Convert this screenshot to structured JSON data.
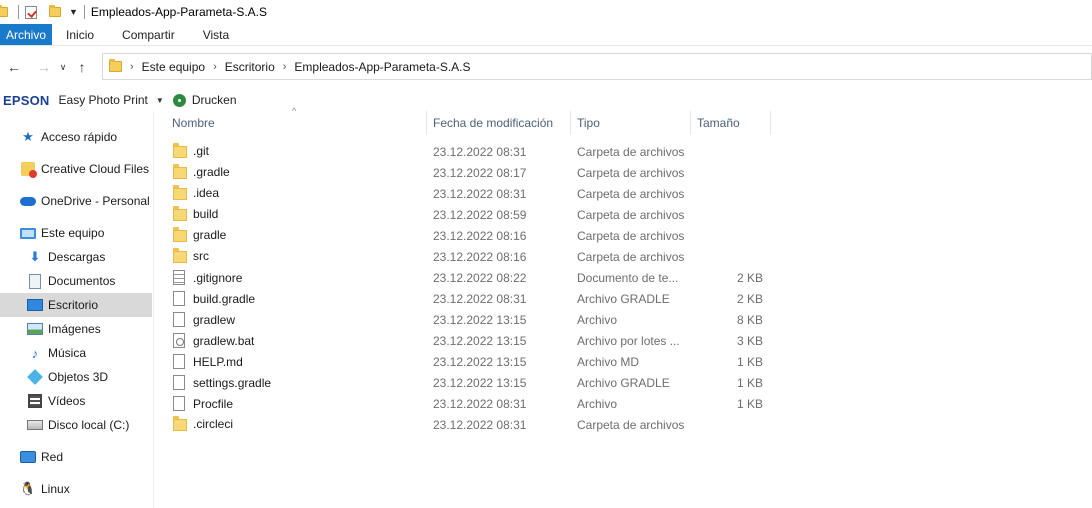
{
  "window": {
    "title": "Empleados-App-Parameta-S.A.S"
  },
  "ribbon": {
    "tabs": [
      {
        "label": "Archivo",
        "active": true
      },
      {
        "label": "Inicio",
        "active": false
      },
      {
        "label": "Compartir",
        "active": false
      },
      {
        "label": "Vista",
        "active": false
      }
    ]
  },
  "address": {
    "crumbs": [
      "Este equipo",
      "Escritorio",
      "Empleados-App-Parameta-S.A.S"
    ]
  },
  "epson_toolbar": {
    "logo": "EPSON",
    "app_label": "Easy Photo Print",
    "print_label": "Drucken"
  },
  "navpane": {
    "items": [
      {
        "label": "Acceso rápido",
        "icon": "star-icon",
        "level": 1
      },
      {
        "label": "Creative Cloud Files",
        "icon": "creative-cloud-icon",
        "level": 1
      },
      {
        "label": "OneDrive - Personal",
        "icon": "onedrive-cloud-icon",
        "level": 1
      },
      {
        "label": "Este equipo",
        "icon": "computer-icon",
        "level": 1
      },
      {
        "label": "Descargas",
        "icon": "download-icon",
        "level": 2
      },
      {
        "label": "Documentos",
        "icon": "document-icon",
        "level": 2
      },
      {
        "label": "Escritorio",
        "icon": "desktop-icon",
        "level": 2,
        "selected": true
      },
      {
        "label": "Imágenes",
        "icon": "pictures-icon",
        "level": 2
      },
      {
        "label": "Música",
        "icon": "music-icon",
        "level": 2
      },
      {
        "label": "Objetos 3D",
        "icon": "3d-objects-icon",
        "level": 2
      },
      {
        "label": "Vídeos",
        "icon": "video-icon",
        "level": 2
      },
      {
        "label": "Disco local (C:)",
        "icon": "disk-icon",
        "level": 2
      },
      {
        "label": "Red",
        "icon": "network-icon",
        "level": 1
      },
      {
        "label": "Linux",
        "icon": "linux-penguin-icon",
        "level": 1
      }
    ]
  },
  "columns": {
    "name": "Nombre",
    "date": "Fecha de modificación",
    "type": "Tipo",
    "size": "Tamaño"
  },
  "files": [
    {
      "name": ".git",
      "date": "23.12.2022 08:31",
      "type": "Carpeta de archivos",
      "size": "",
      "icon": "folder"
    },
    {
      "name": ".gradle",
      "date": "23.12.2022 08:17",
      "type": "Carpeta de archivos",
      "size": "",
      "icon": "folder"
    },
    {
      "name": ".idea",
      "date": "23.12.2022 08:31",
      "type": "Carpeta de archivos",
      "size": "",
      "icon": "folder"
    },
    {
      "name": "build",
      "date": "23.12.2022 08:59",
      "type": "Carpeta de archivos",
      "size": "",
      "icon": "folder"
    },
    {
      "name": "gradle",
      "date": "23.12.2022 08:16",
      "type": "Carpeta de archivos",
      "size": "",
      "icon": "folder"
    },
    {
      "name": "src",
      "date": "23.12.2022 08:16",
      "type": "Carpeta de archivos",
      "size": "",
      "icon": "folder"
    },
    {
      "name": ".gitignore",
      "date": "23.12.2022 08:22",
      "type": "Documento de te...",
      "size": "2 KB",
      "icon": "text"
    },
    {
      "name": "build.gradle",
      "date": "23.12.2022 08:31",
      "type": "Archivo GRADLE",
      "size": "2 KB",
      "icon": "file"
    },
    {
      "name": "gradlew",
      "date": "23.12.2022 13:15",
      "type": "Archivo",
      "size": "8 KB",
      "icon": "file"
    },
    {
      "name": "gradlew.bat",
      "date": "23.12.2022 13:15",
      "type": "Archivo por lotes ...",
      "size": "3 KB",
      "icon": "bat"
    },
    {
      "name": "HELP.md",
      "date": "23.12.2022 13:15",
      "type": "Archivo MD",
      "size": "1 KB",
      "icon": "file"
    },
    {
      "name": "settings.gradle",
      "date": "23.12.2022 13:15",
      "type": "Archivo GRADLE",
      "size": "1 KB",
      "icon": "file"
    },
    {
      "name": "Procfile",
      "date": "23.12.2022 08:31",
      "type": "Archivo",
      "size": "1 KB",
      "icon": "file"
    },
    {
      "name": ".circleci",
      "date": "23.12.2022 08:31",
      "type": "Carpeta de archivos",
      "size": "",
      "icon": "folder"
    }
  ]
}
